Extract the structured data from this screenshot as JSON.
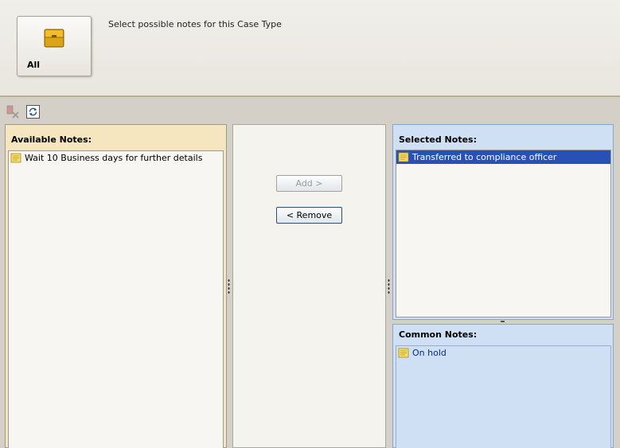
{
  "header": {
    "category_tile": {
      "label": "All",
      "icon": "briefcase-icon"
    },
    "description": "Select possible notes for this Case Type"
  },
  "toolbar": {
    "delete_icon": "delete-note-icon",
    "refresh_icon": "refresh-icon"
  },
  "available_notes": {
    "title": "Available Notes:",
    "items": [
      "Wait 10 Business days for further details"
    ]
  },
  "actions": {
    "add_label": "Add >",
    "remove_label": "< Remove"
  },
  "selected_notes": {
    "title": "Selected Notes:",
    "items": [
      "Transferred to compliance officer"
    ]
  },
  "common_notes": {
    "title": "Common Notes:",
    "items": [
      "On hold"
    ]
  },
  "colors": {
    "available_bg": "#f5e6c0",
    "selected_bg": "#cfe0f4",
    "selection_highlight": "#2751b6",
    "tile_accent": "#d9a414"
  }
}
